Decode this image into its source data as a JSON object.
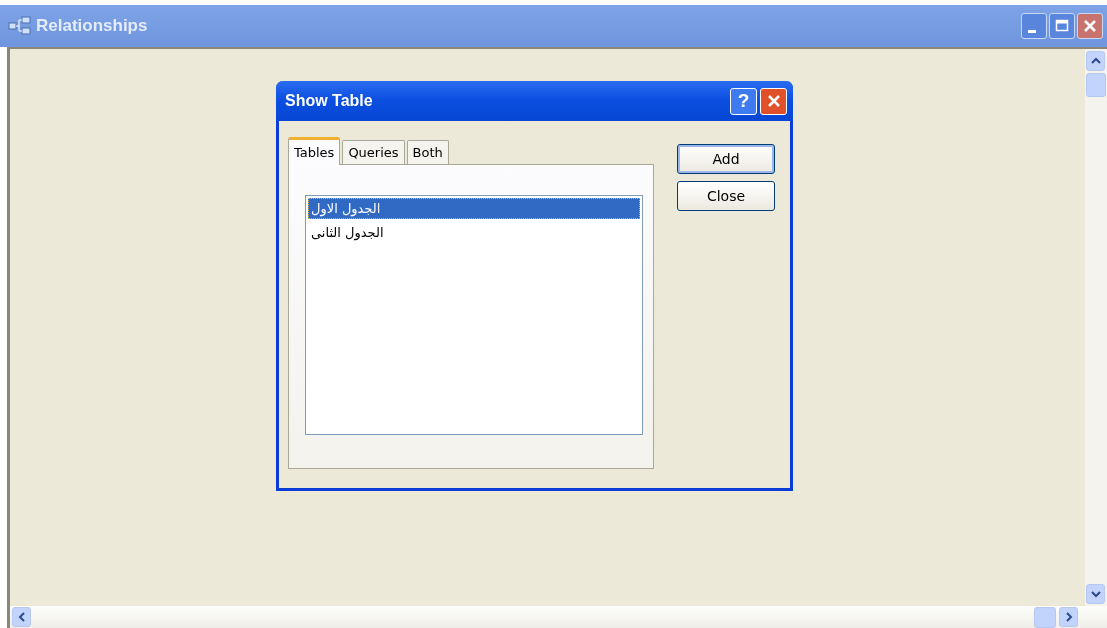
{
  "window": {
    "title": "Relationships"
  },
  "dialog": {
    "title": "Show Table",
    "help": "?",
    "tabs": [
      {
        "label": "Tables",
        "selected": true
      },
      {
        "label": "Queries",
        "selected": false
      },
      {
        "label": "Both",
        "selected": false
      }
    ],
    "items": [
      {
        "label": "الجدول الاول",
        "selected": true
      },
      {
        "label": "الجدول الثانى",
        "selected": false
      }
    ],
    "buttons": [
      "Add",
      "Close"
    ]
  }
}
